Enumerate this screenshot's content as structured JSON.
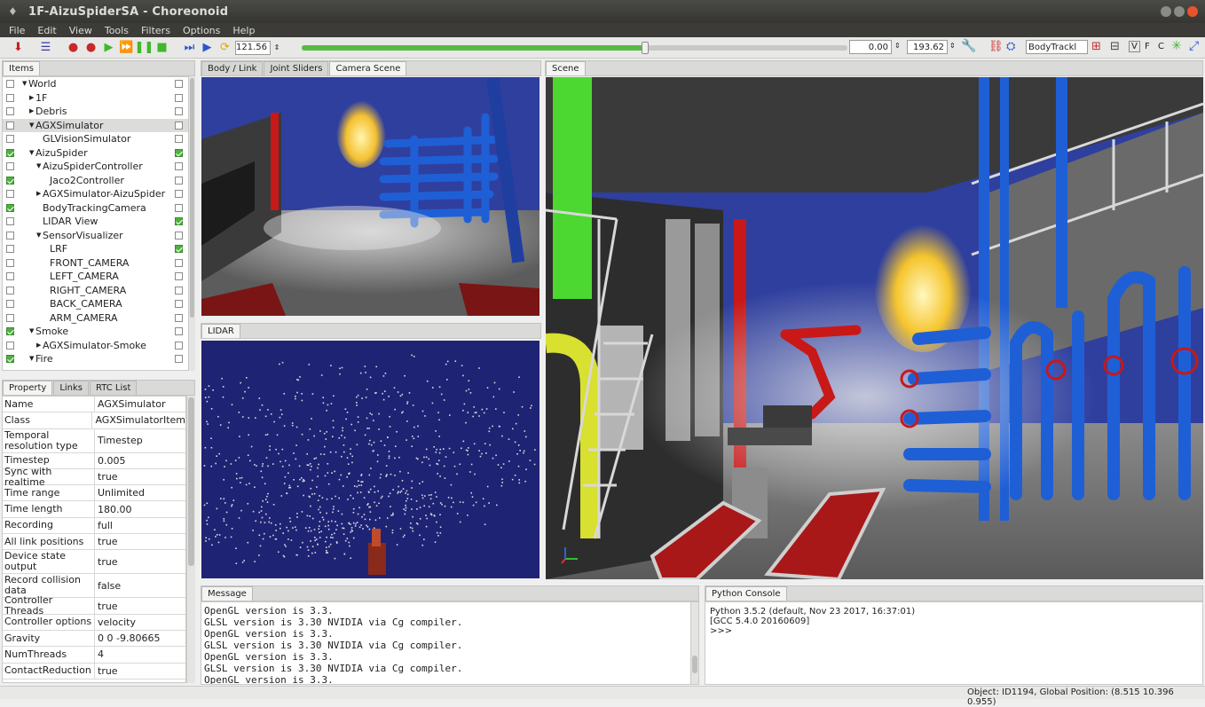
{
  "window": {
    "title": "1F-AizuSpiderSA - Choreonoid"
  },
  "menu": [
    "File",
    "Edit",
    "View",
    "Tools",
    "Filters",
    "Options",
    "Help"
  ],
  "toolbar": {
    "time_value": "121.56",
    "range_start": "0.00",
    "range_end": "193.62",
    "slider_fraction": 0.63,
    "body_tracking_select": "BodyTrackl",
    "letters": [
      "V",
      "F",
      "C"
    ]
  },
  "items_panel": {
    "tab": "Items",
    "rows": [
      {
        "label": "World",
        "indent": 0,
        "arrow": "▼",
        "left_checked": false,
        "right_checked": false,
        "selected": false
      },
      {
        "label": "1F",
        "indent": 1,
        "arrow": "▶",
        "left_checked": false,
        "right_checked": false,
        "selected": false
      },
      {
        "label": "Debris",
        "indent": 1,
        "arrow": "▶",
        "left_checked": false,
        "right_checked": false,
        "selected": false
      },
      {
        "label": "AGXSimulator",
        "indent": 1,
        "arrow": "▼",
        "left_checked": false,
        "right_checked": false,
        "selected": true
      },
      {
        "label": "GLVisionSimulator",
        "indent": 2,
        "arrow": "",
        "left_checked": false,
        "right_checked": false,
        "selected": false
      },
      {
        "label": "AizuSpider",
        "indent": 1,
        "arrow": "▼",
        "left_checked": true,
        "right_checked": true,
        "selected": false
      },
      {
        "label": "AizuSpiderController",
        "indent": 2,
        "arrow": "▼",
        "left_checked": false,
        "right_checked": false,
        "selected": false
      },
      {
        "label": "Jaco2Controller",
        "indent": 3,
        "arrow": "",
        "left_checked": true,
        "right_checked": false,
        "selected": false
      },
      {
        "label": "AGXSimulator-AizuSpider",
        "indent": 2,
        "arrow": "▶",
        "left_checked": false,
        "right_checked": false,
        "selected": false
      },
      {
        "label": "BodyTrackingCamera",
        "indent": 2,
        "arrow": "",
        "left_checked": true,
        "right_checked": false,
        "selected": false
      },
      {
        "label": "LIDAR View",
        "indent": 2,
        "arrow": "",
        "left_checked": false,
        "right_checked": true,
        "selected": false
      },
      {
        "label": "SensorVisualizer",
        "indent": 2,
        "arrow": "▼",
        "left_checked": false,
        "right_checked": false,
        "selected": false
      },
      {
        "label": "LRF",
        "indent": 3,
        "arrow": "",
        "left_checked": false,
        "right_checked": true,
        "selected": false
      },
      {
        "label": "FRONT_CAMERA",
        "indent": 3,
        "arrow": "",
        "left_checked": false,
        "right_checked": false,
        "selected": false
      },
      {
        "label": "LEFT_CAMERA",
        "indent": 3,
        "arrow": "",
        "left_checked": false,
        "right_checked": false,
        "selected": false
      },
      {
        "label": "RIGHT_CAMERA",
        "indent": 3,
        "arrow": "",
        "left_checked": false,
        "right_checked": false,
        "selected": false
      },
      {
        "label": "BACK_CAMERA",
        "indent": 3,
        "arrow": "",
        "left_checked": false,
        "right_checked": false,
        "selected": false
      },
      {
        "label": "ARM_CAMERA",
        "indent": 3,
        "arrow": "",
        "left_checked": false,
        "right_checked": false,
        "selected": false
      },
      {
        "label": "Smoke",
        "indent": 1,
        "arrow": "▼",
        "left_checked": true,
        "right_checked": false,
        "selected": false
      },
      {
        "label": "AGXSimulator-Smoke",
        "indent": 2,
        "arrow": "▶",
        "left_checked": false,
        "right_checked": false,
        "selected": false
      },
      {
        "label": "Fire",
        "indent": 1,
        "arrow": "▼",
        "left_checked": true,
        "right_checked": false,
        "selected": false
      }
    ]
  },
  "property_panel": {
    "tabs": [
      "Property",
      "Links",
      "RTC List"
    ],
    "rows": [
      {
        "key": "Name",
        "value": "AGXSimulator"
      },
      {
        "key": "Class",
        "value": "AGXSimulatorItem"
      },
      {
        "key": "Temporal resolution type",
        "value": "Timestep"
      },
      {
        "key": "Timestep",
        "value": "0.005"
      },
      {
        "key": "Sync with realtime",
        "value": "true"
      },
      {
        "key": "Time range",
        "value": "Unlimited"
      },
      {
        "key": "Time length",
        "value": "180.00"
      },
      {
        "key": "Recording",
        "value": "full"
      },
      {
        "key": "All link positions",
        "value": "true"
      },
      {
        "key": "Device state output",
        "value": "true"
      },
      {
        "key": "Record collision data",
        "value": "false"
      },
      {
        "key": "Controller Threads",
        "value": "true"
      },
      {
        "key": "Controller options",
        "value": "velocity"
      },
      {
        "key": "Gravity",
        "value": "0 0 -9.80665"
      },
      {
        "key": "NumThreads",
        "value": "4"
      },
      {
        "key": "ContactReduction",
        "value": "true"
      }
    ]
  },
  "center_top_tabs": [
    "Body / Link",
    "Joint Sliders",
    "Camera Scene"
  ],
  "lidar_tab": "LIDAR",
  "scene_tab": "Scene",
  "message_panel": {
    "tab": "Message",
    "lines": [
      "OpenGL version is 3.3.",
      "GLSL version is 3.30 NVIDIA via Cg compiler.",
      "OpenGL version is 3.3.",
      "GLSL version is 3.30 NVIDIA via Cg compiler.",
      "OpenGL version is 3.3.",
      "GLSL version is 3.30 NVIDIA via Cg compiler.",
      "OpenGL version is 3.3."
    ]
  },
  "python_console": {
    "tab": "Python Console",
    "lines": [
      "Python 3.5.2 (default, Nov 23 2017, 16:37:01)",
      "[GCC 5.4.0 20160609]",
      ">>>"
    ]
  },
  "status_bar": {
    "text": "Object: ID1194, Global Position: (8.515 10.396 0.955)"
  },
  "colors": {
    "sky": "#2f3f9e",
    "pipe_blue": "#1f5fd6",
    "pipe_red": "#d01818",
    "pipe_green": "#4cd830",
    "lidar_bg": "#1e2374"
  }
}
